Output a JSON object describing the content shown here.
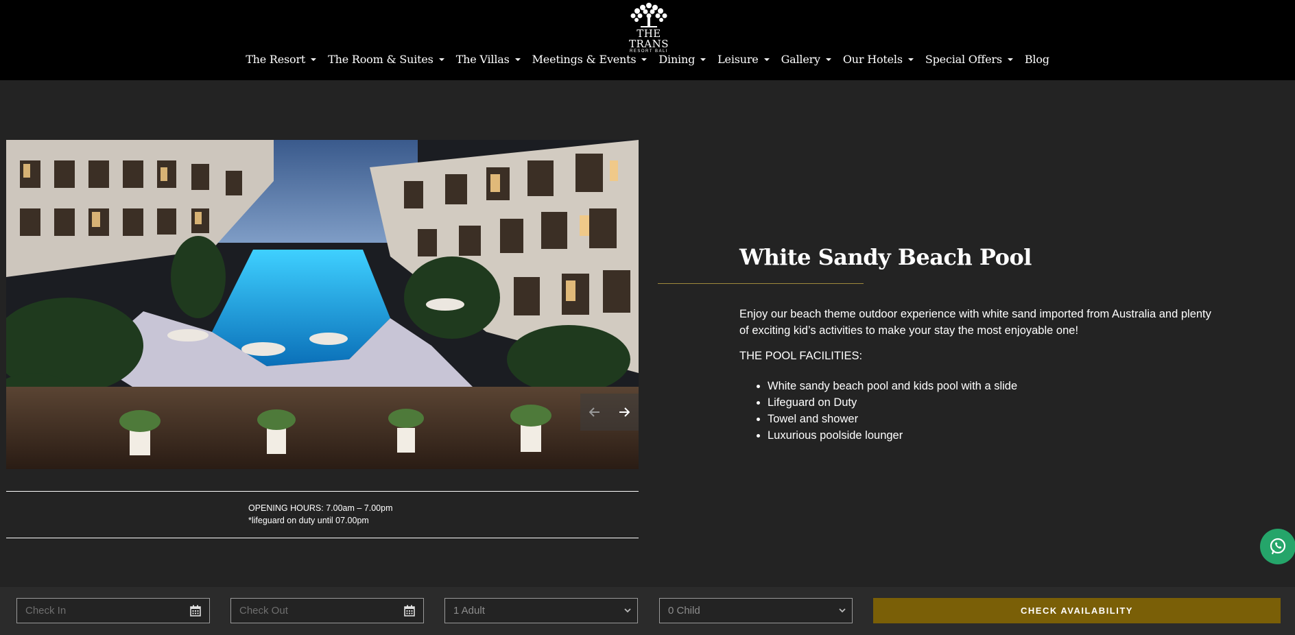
{
  "brand": {
    "name": "THE TRANS",
    "subtitle": "RESORT BALI",
    "logo_icon": "tree-logo-icon"
  },
  "nav": {
    "items": [
      {
        "label": "The Resort",
        "dropdown": true
      },
      {
        "label": "The Room & Suites",
        "dropdown": true
      },
      {
        "label": "The Villas",
        "dropdown": true
      },
      {
        "label": "Meetings & Events",
        "dropdown": true
      },
      {
        "label": "Dining",
        "dropdown": true
      },
      {
        "label": "Leisure",
        "dropdown": true
      },
      {
        "label": "Gallery",
        "dropdown": true
      },
      {
        "label": "Our Hotels",
        "dropdown": true
      },
      {
        "label": "Special Offers",
        "dropdown": true
      },
      {
        "label": "Blog",
        "dropdown": false
      }
    ]
  },
  "carousel": {
    "prev_icon": "arrow-left-icon",
    "next_icon": "arrow-right-icon"
  },
  "hours": {
    "label": "OPENING HOURS",
    "value": ": 7.00am – 7.00pm",
    "note": "*lifeguard on duty until 07.00pm"
  },
  "content": {
    "title": "White Sandy Beach Pool",
    "description": "Enjoy our beach theme outdoor experience with white sand imported from Australia and plenty of exciting kid’s activities to make your stay the most enjoyable one!",
    "facilities_heading": "THE POOL FACILITIES:",
    "facilities": [
      "White sandy beach pool and kids pool with a slide",
      "Lifeguard on Duty",
      "Towel and shower",
      "Luxurious poolside lounger"
    ]
  },
  "booking": {
    "check_in_placeholder": "Check In",
    "check_out_placeholder": "Check Out",
    "adults": "1 Adult",
    "children": "0 Child",
    "button": "CHECK AVAILABILITY"
  },
  "colors": {
    "header_bg": "#000000",
    "page_bg": "#232323",
    "accent_gold": "#7a5f07",
    "whatsapp_green": "#25a56a"
  }
}
